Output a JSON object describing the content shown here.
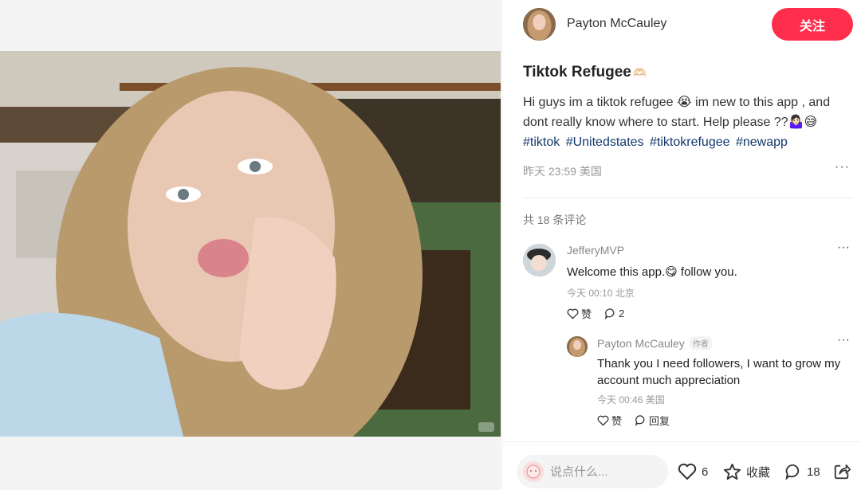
{
  "author": {
    "name": "Payton McCauley",
    "follow_label": "关注"
  },
  "note": {
    "title": "Tiktok Refugee",
    "title_emoji": "🫶🏻",
    "body": "Hi guys im a tiktok refugee 😭 im new to this app , and dont really know where to start. Help please ??🤷🏻‍♀️😅",
    "tags": [
      "#tiktok",
      "#Unitedstates",
      "#tiktokrefugee",
      "#newapp"
    ],
    "meta": "昨天 23:59 美国",
    "more": "···"
  },
  "comments_header": "共 18 条评论",
  "comments": [
    {
      "user": "JefferyMVP",
      "text": "Welcome this app.😋 follow you.",
      "meta": "今天 00:10 北京",
      "like_label": "赞",
      "reply_count": "2",
      "more": "···",
      "replies": [
        {
          "user": "Payton McCauley",
          "badge": "作者",
          "text": "Thank you I need followers, I want to grow my account much appreciation",
          "meta": "今天 00:46 美国",
          "like_label": "赞",
          "reply_label": "回复",
          "more": "···"
        }
      ]
    }
  ],
  "bottom_bar": {
    "input_placeholder": "说点什么...",
    "like_count": "6",
    "collect_label": "收藏",
    "comment_count": "18"
  },
  "colors": {
    "accent": "#ff2e4d",
    "tag": "#13386c"
  },
  "icons": [
    "heart-icon",
    "star-icon",
    "comment-bubble-icon",
    "share-icon",
    "ellipsis-icon"
  ]
}
